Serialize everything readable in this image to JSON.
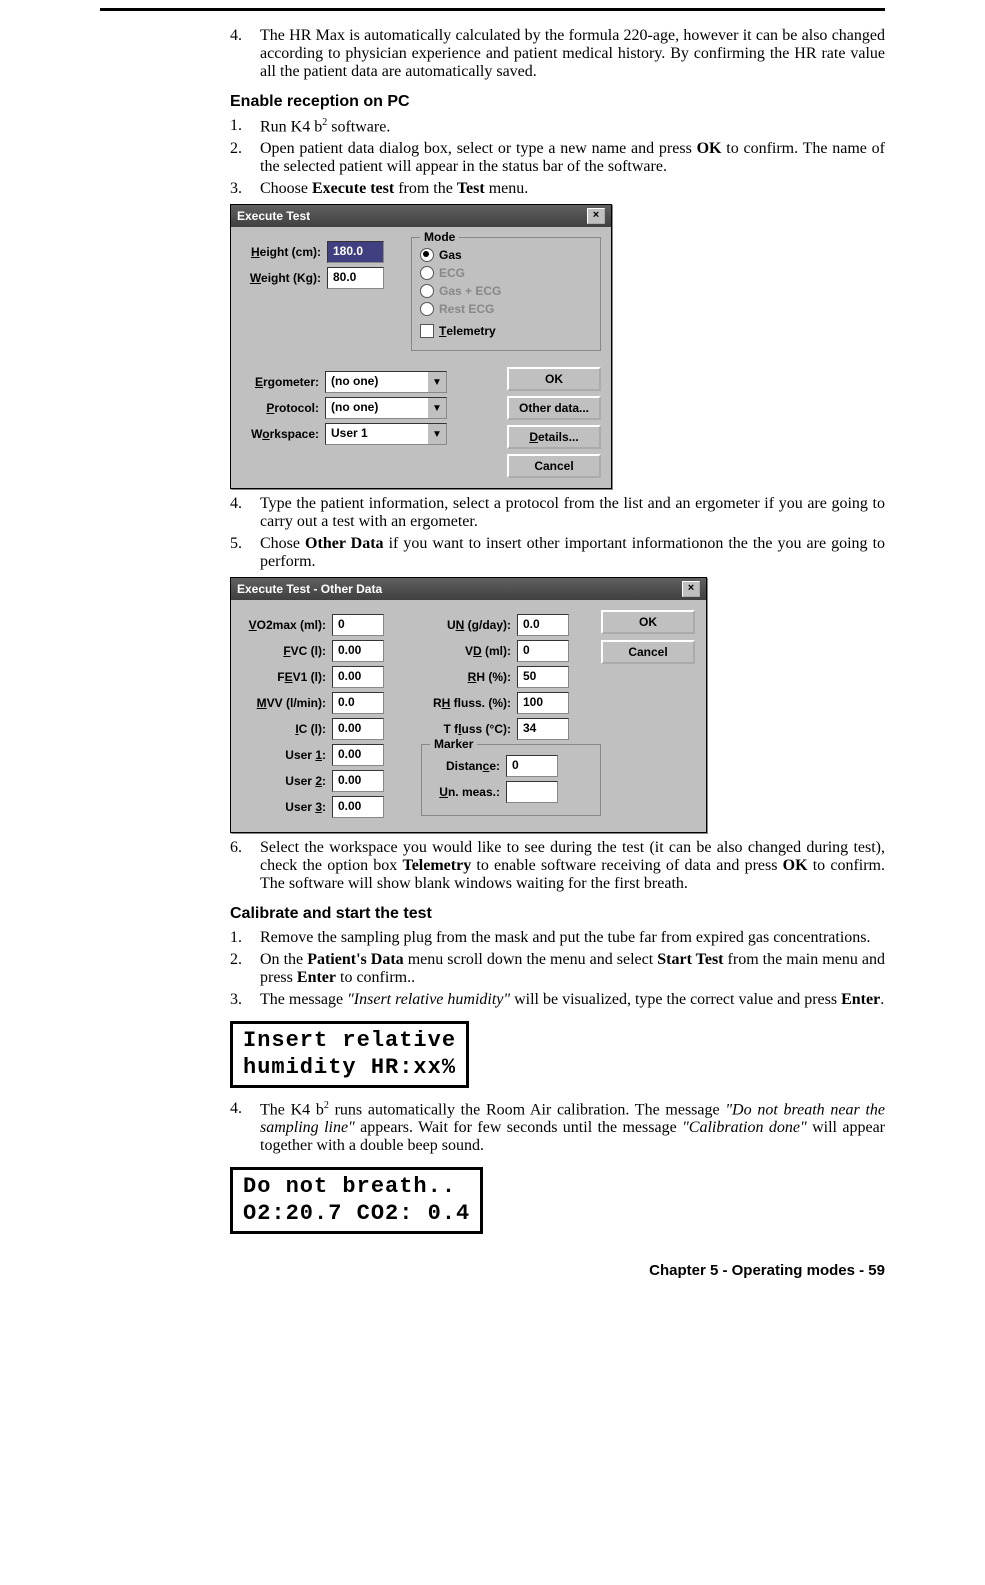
{
  "section_a": {
    "items": [
      {
        "n": "4.",
        "t": "The HR Max is automatically calculated by the formula 220-age, however it can be also changed according to physician experience and patient medical history. By confirming the HR rate value all the patient data are automatically saved."
      }
    ]
  },
  "heading_b": "Enable reception on PC",
  "section_b": {
    "i1n": "1.",
    "i1a": "Run K4 b",
    "i1sup": "2",
    "i1b": " software.",
    "i2n": "2.",
    "i2a": "Open patient data dialog box, select or type a new name and press ",
    "i2b": "OK",
    "i2c": " to confirm. The name of the selected patient will appear in the status bar of the software.",
    "i3n": "3.",
    "i3a": "Choose ",
    "i3b": "Execute test",
    "i3c": " from the ",
    "i3d": "Test",
    "i3e": " menu."
  },
  "dlg1": {
    "title": "Execute Test",
    "height_lbl": "Height (cm):",
    "height_val": "180.0",
    "weight_lbl": "Weight (Kg):",
    "weight_val": "80.0",
    "mode_legend": "Mode",
    "r_gas": "Gas",
    "r_ecg": "ECG",
    "r_gasecg": "Gas + ECG",
    "r_rest": "Rest ECG",
    "chk_tel": "Telemetry",
    "erg_lbl": "Ergometer:",
    "erg_val": "(no one)",
    "prot_lbl": "Protocol:",
    "prot_val": "(no one)",
    "ws_lbl": "Workspace:",
    "ws_val": "User 1",
    "btn_ok": "OK",
    "btn_other": "Other data...",
    "btn_details": "Details...",
    "btn_cancel": "Cancel"
  },
  "section_c": {
    "i4n": "4.",
    "i4": "Type the patient information, select a protocol from the list and an ergometer  if you are going to carry out a test with an ergometer.",
    "i5n": "5.",
    "i5a": "Chose ",
    "i5b": "Other  Data",
    "i5c": " if you want to insert other important informationon the the you are going to perform."
  },
  "dlg2": {
    "title": "Execute Test - Other Data",
    "vo2_lbl": "VO2max (ml):",
    "vo2_val": "0",
    "fvc_lbl": "FVC (l):",
    "fvc_val": "0.00",
    "fev_lbl": "FEV1 (l):",
    "fev_val": "0.00",
    "mvv_lbl": "MVV (l/min):",
    "mvv_val": "0.0",
    "ic_lbl": "IC (l):",
    "ic_val": "0.00",
    "u1_lbl": "User 1:",
    "u1_val": "0.00",
    "u2_lbl": "User 2:",
    "u2_val": "0.00",
    "u3_lbl": "User 3:",
    "u3_val": "0.00",
    "un_lbl": "UN (g/day):",
    "un_val": "0.0",
    "vd_lbl": "VD (ml):",
    "vd_val": "0",
    "rh_lbl": "RH (%):",
    "rh_val": "50",
    "rhf_lbl": "RH fluss. (%):",
    "rhf_val": "100",
    "tf_lbl": "T fluss (°C):",
    "tf_val": "34",
    "marker_legend": "Marker",
    "dist_lbl": "Distance:",
    "dist_val": "0",
    "um_lbl": "Un. meas.:",
    "um_val": "",
    "btn_ok": "OK",
    "btn_cancel": "Cancel"
  },
  "section_d": {
    "i6n": "6.",
    "i6a": "Select the workspace you would like to see during the test (it can be also changed during test), check the option box ",
    "i6b": "Telemetry",
    "i6c": " to enable software receiving of data and press ",
    "i6d": "OK",
    "i6e": " to confirm. The software will show blank windows waiting for the first breath."
  },
  "heading_e": "Calibrate and start the test",
  "section_e": {
    "i1n": "1.",
    "i1": "Remove the sampling plug from the mask and put the tube far from expired gas concentrations.",
    "i2n": "2.",
    "i2a": "On the ",
    "i2b": "Patient's Data",
    "i2c": " menu scroll down the menu and select ",
    "i2d": "Start Test",
    "i2e": " from the main menu and press ",
    "i2f": "Enter",
    "i2g": " to confirm..",
    "i3n": "3.",
    "i3a": "The message ",
    "i3b": "\"Insert relative humidity\"",
    "i3c": " will be visualized, type the correct value and press ",
    "i3d": "Enter",
    "i3e": "."
  },
  "lcd1_l1": "Insert relative",
  "lcd1_l2": "humidity HR:xx%",
  "section_f": {
    "i4n": "4.",
    "i4a": "The K4 b",
    "i4sup": "2",
    "i4b": " runs automatically the Room Air calibration. The message ",
    "i4c": "\"Do not breath near the sampling line\"",
    "i4d": " appears. Wait for few seconds until the message ",
    "i4e": "\"Calibration done\"",
    "i4f": " will appear together with a double beep sound."
  },
  "lcd2_l1": "Do not breath..",
  "lcd2_l2": "O2:20.7 CO2: 0.4",
  "footer": "Chapter 5 - Operating modes - 59"
}
